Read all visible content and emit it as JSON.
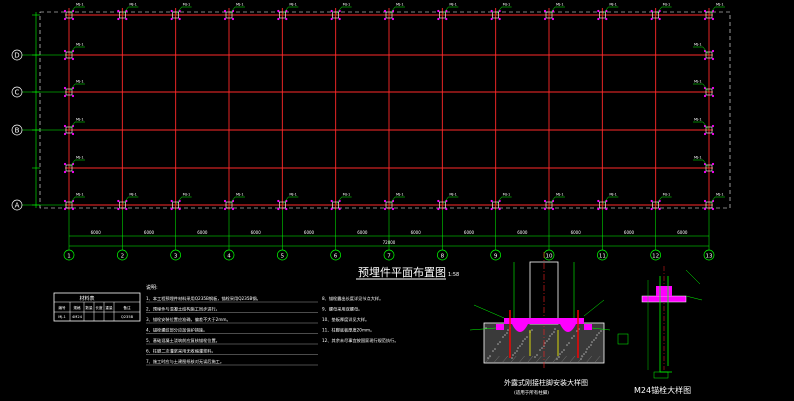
{
  "drawing": {
    "title": "预埋件平面布置图",
    "title_scale": "1:58",
    "row_axis_labels": [
      "A",
      "B",
      "C",
      "D"
    ],
    "column_axis_labels": [
      "1",
      "2",
      "3",
      "4",
      "5",
      "6",
      "7",
      "8",
      "9",
      "10",
      "11",
      "12",
      "13"
    ],
    "embed_tag": "MJ-1",
    "notes_heading": "说明:",
    "notes": [
      "1、本工程预埋件材料采用Q235B钢板，锚栓采用Q235B钢。",
      "2、预埋件与混凝土结构施工同步进行。",
      "3、锚栓安装位置应准确，偏差不大于2mm。",
      "4、锚栓螺纹部分应加保护措施。",
      "5、基础混凝土浇筑前应复核锚栓位置。",
      "6、柱脚二次灌浆采用无收缩灌浆料。",
      "7、施工时应与土建图纸核对无误后施工。"
    ],
    "notes_right": [
      "8、锚栓露出长度详见节点大样。",
      "9、螺母采用双螺母。",
      "10、垫板厚度详见大样。",
      "11、柱脚底板厚度20mm。",
      "12、其余未尽事宜按国家现行规范执行。"
    ],
    "table_title": "材料表",
    "table_headers": [
      "编号",
      "规格",
      "数量",
      "长度",
      "重量",
      "备注"
    ],
    "table_row": [
      "MJ-1",
      "4M24",
      "",
      "",
      "",
      "Q235B"
    ],
    "detail1_title": "外露式刚接柱脚安装大样图",
    "detail1_subtitle": "(适用于所有柱脚)",
    "detail2_title": "M24锚栓大样图",
    "dimension_label": "6000",
    "total_dimension_label": "72000"
  }
}
